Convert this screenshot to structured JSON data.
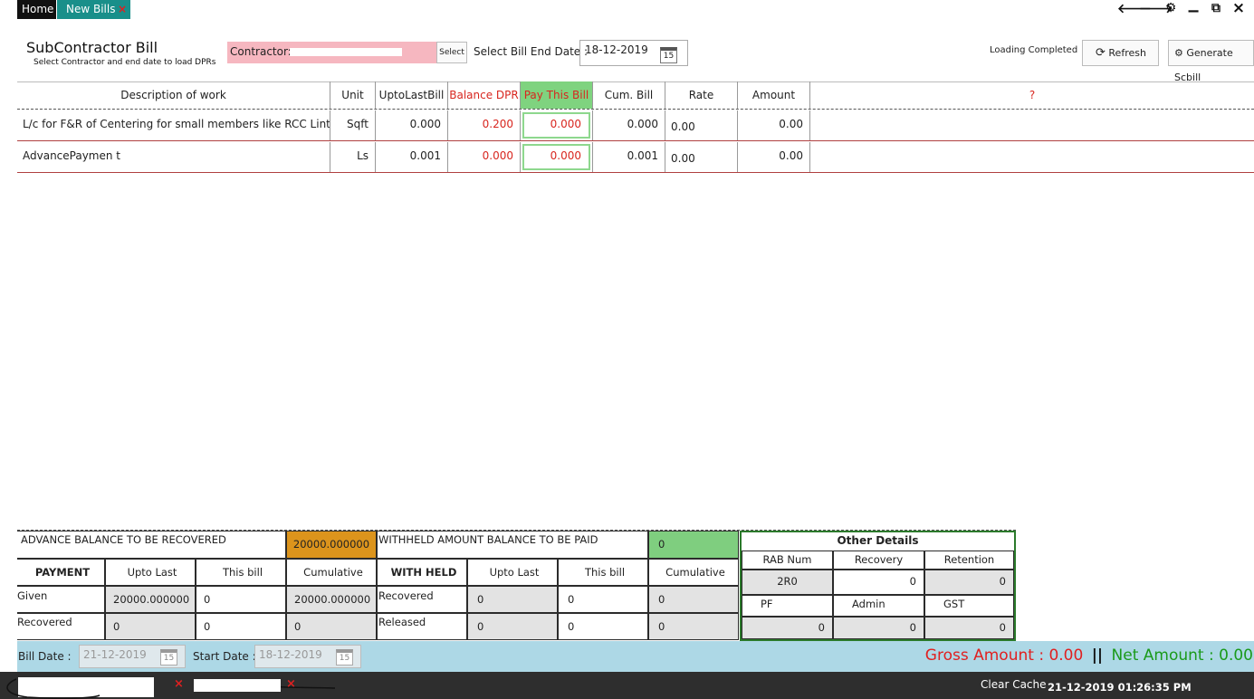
{
  "tabs": {
    "home": "Home",
    "new_bills": "New Bills",
    "close_glyph": "×"
  },
  "window_controls": {
    "back": "🡐",
    "forward": "🡒",
    "settings": "⚙",
    "minimize": "▁",
    "restore": "⧉",
    "close": "×"
  },
  "header": {
    "title": "SubContractor Bill",
    "subtitle": "Select Contractor and end date to load DPRs",
    "contractor_label": "Contractor:",
    "select_button": "Select",
    "bill_end_label": "Select Bill End Date :",
    "bill_end_date": "18-12-2019",
    "calendar_day": "15",
    "loading_status": "Loading Completed",
    "refresh_label": "Refresh",
    "generate_label": "Generate Scbill"
  },
  "table": {
    "headers": [
      "Description of work",
      "Unit",
      "UptoLastBill",
      "Balance DPR",
      "Pay This Bill",
      "Cum. Bill",
      "Rate",
      "Amount",
      "?"
    ],
    "rows": [
      {
        "description": "L/c for F&R of Centering for small members like RCC Lintel, s",
        "unit": "Sqft",
        "upto_last": "0.000",
        "balance_dpr": "0.200",
        "pay_this_bill": "0.000",
        "cum_bill": "0.000",
        "rate": "0.00",
        "amount": "0.00"
      },
      {
        "description": "AdvancePaymen t",
        "unit": "Ls",
        "upto_last": "0.001",
        "balance_dpr": "0.000",
        "pay_this_bill": "0.000",
        "cum_bill": "0.001",
        "rate": "0.00",
        "amount": "0.00"
      }
    ]
  },
  "advance": {
    "title": "ADVANCE BALANCE TO BE RECOVERED",
    "balance": "20000.000000",
    "headers": [
      "PAYMENT",
      "Upto Last",
      "This bill",
      "Cumulative"
    ],
    "given": {
      "label": "Given",
      "upto_last": "20000.000000",
      "this_bill": "0",
      "cumulative": "20000.000000"
    },
    "recovered": {
      "label": "Recovered",
      "upto_last": "0",
      "this_bill": "0",
      "cumulative": "0"
    }
  },
  "withheld": {
    "title": "WITHHELD AMOUNT BALANCE TO BE PAID",
    "balance": "0",
    "headers": [
      "WITH HELD",
      "Upto Last",
      "This bill",
      "Cumulative"
    ],
    "recovered": {
      "label": "Recovered",
      "upto_last": "0",
      "this_bill": "0",
      "cumulative": "0"
    },
    "released": {
      "label": "Released",
      "upto_last": "0",
      "this_bill": "0",
      "cumulative": "0"
    }
  },
  "other": {
    "title": "Other Details",
    "rab_label": "RAB Num",
    "rab_value": "2R0",
    "recovery_label": "Recovery",
    "recovery_value": "0",
    "retention_label": "Retention",
    "retention_value": "0",
    "pf_label": "PF",
    "pf_value": "0",
    "admin_label": "Admin",
    "admin_value": "0",
    "gst_label": "GST",
    "gst_value": "0"
  },
  "footer": {
    "bill_date_label": "Bill Date :",
    "bill_date": "21-12-2019",
    "start_date_label": "Start Date :",
    "start_date": "18-12-2019",
    "gross_label": "Gross Amount :",
    "gross_value": "0.00",
    "separator": "||",
    "net_label": "Net Amount :",
    "net_value": "0.00"
  },
  "status": {
    "clear_cache": "Clear Cache",
    "datetime": "21-12-2019 01:26:35 PM"
  },
  "colors": {
    "tab_teal": "#198f8a",
    "pay_green": "#7fd37f",
    "balance_orange": "#dc941c",
    "withheld_green": "#7fce7f",
    "bottom_blue": "#add8e6",
    "gross_red": "#e02020",
    "net_green": "#1a9a1a"
  }
}
